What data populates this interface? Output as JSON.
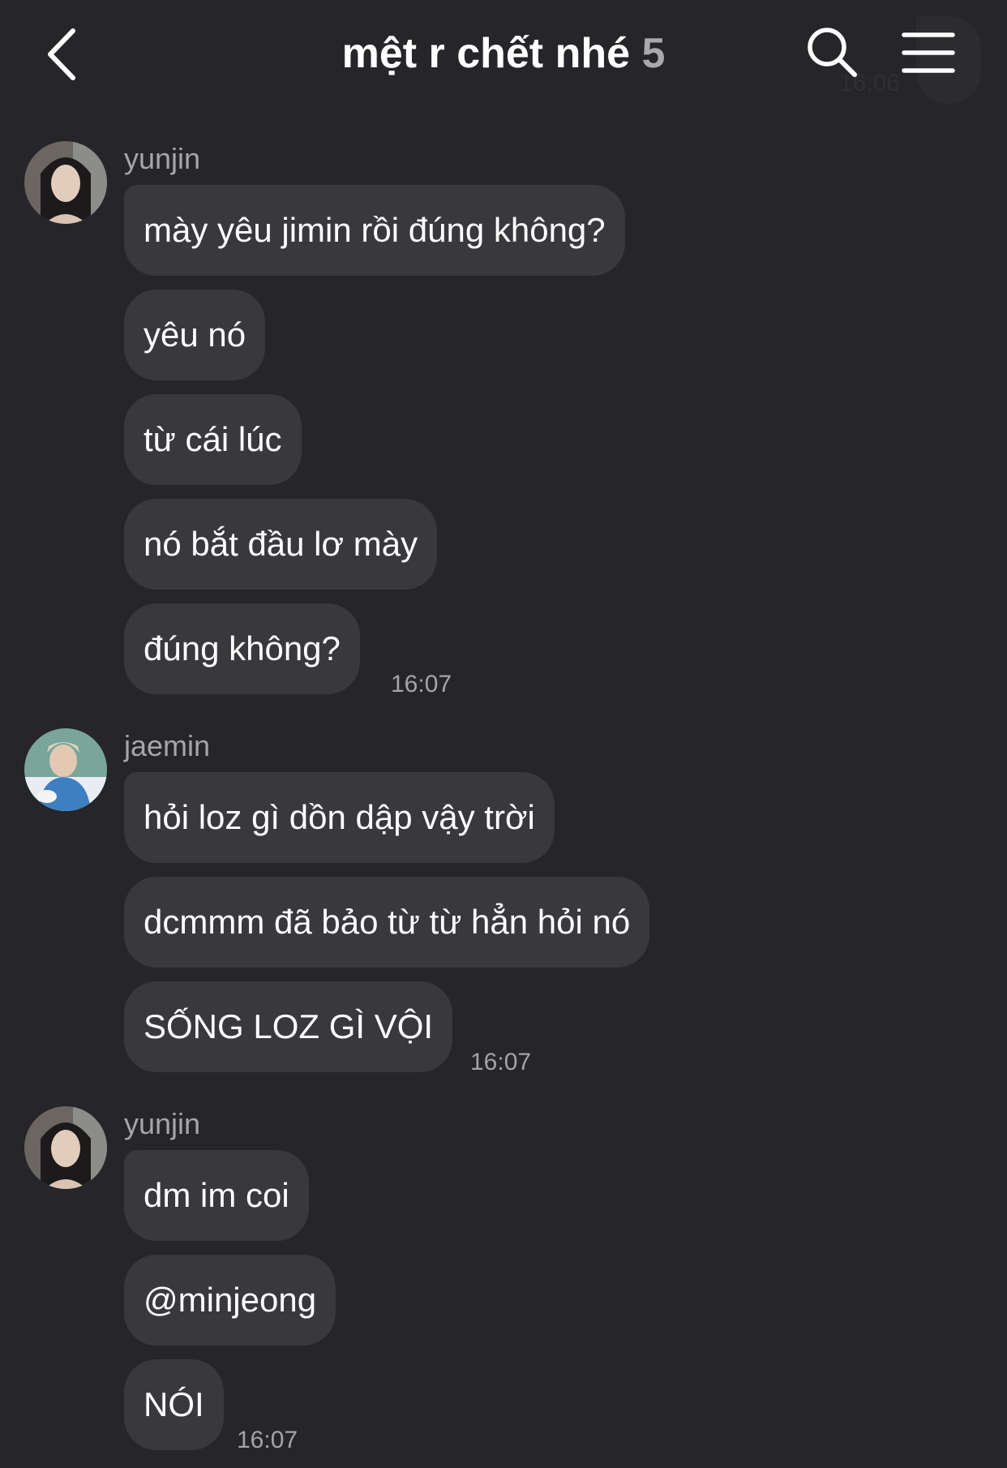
{
  "header": {
    "title": "mệt r chết nhé",
    "member_count": "5",
    "faded_time": "16:06"
  },
  "icons": {
    "back": "chevron-left-icon",
    "search": "search-icon",
    "menu": "hamburger-menu-icon"
  },
  "colors": {
    "background": "#25252a",
    "bubble": "#38383d",
    "meta_text": "#a5a5aa"
  },
  "groups": [
    {
      "sender": "yunjin",
      "messages": [
        "mày yêu jimin rồi đúng không?",
        "yêu nó",
        "từ cái lúc",
        "nó bắt đầu lơ mày",
        "đúng không?"
      ],
      "time": "16:07"
    },
    {
      "sender": "jaemin",
      "messages": [
        "hỏi loz gì dồn dập vậy trời",
        "dcmmm đã bảo từ từ hẳn hỏi nó",
        "SỐNG LOZ GÌ VỘI"
      ],
      "time": "16:07"
    },
    {
      "sender": "yunjin",
      "messages": [
        "dm im coi",
        "@minjeong",
        "NÓI"
      ],
      "time": "16:07"
    }
  ]
}
